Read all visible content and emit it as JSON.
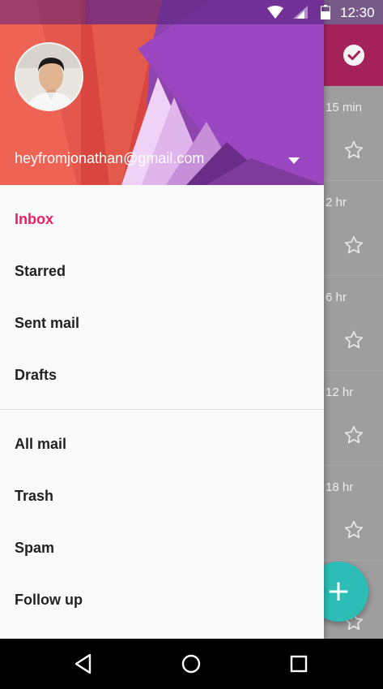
{
  "status_bar": {
    "time": "12:30",
    "icons": [
      "wifi-icon",
      "cell-signal-icon",
      "battery-icon"
    ]
  },
  "background_list": {
    "app_bar_color": "#a6225a",
    "action_icon": "check-circle-icon",
    "rows": [
      {
        "time": "15 min"
      },
      {
        "time": "2 hr"
      },
      {
        "time": "6 hr"
      },
      {
        "time": "12 hr"
      },
      {
        "time": "18 hr"
      }
    ],
    "fab_label": "+"
  },
  "drawer": {
    "account": {
      "email": "heyfromjonathan@gmail.com"
    },
    "primary_items": [
      {
        "label": "Inbox",
        "active": true
      },
      {
        "label": "Starred"
      },
      {
        "label": "Sent mail"
      },
      {
        "label": "Drafts"
      }
    ],
    "secondary_items": [
      {
        "label": "All mail"
      },
      {
        "label": "Trash"
      },
      {
        "label": "Spam"
      },
      {
        "label": "Follow up"
      }
    ],
    "accent_color": "#e91e63"
  },
  "navigation_bar": {
    "buttons": [
      "back-icon",
      "home-icon",
      "recents-icon"
    ]
  }
}
